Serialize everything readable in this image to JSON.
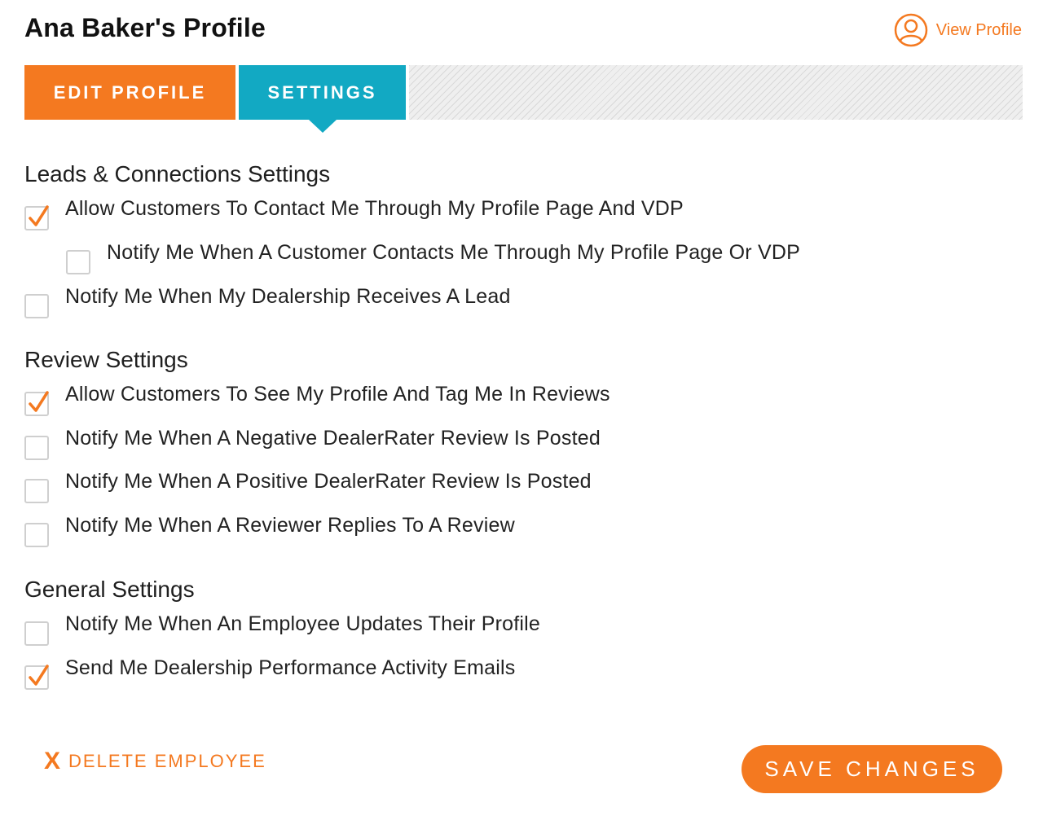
{
  "header": {
    "title": "Ana Baker's Profile",
    "view_profile_label": "View Profile"
  },
  "tabs": [
    {
      "label": "EDIT PROFILE",
      "active": false
    },
    {
      "label": "SETTINGS",
      "active": true
    }
  ],
  "sections": [
    {
      "title": "Leads & Connections Settings",
      "options": [
        {
          "label": "Allow Customers To Contact Me Through My Profile Page And VDP",
          "checked": true
        },
        {
          "label": "Notify Me When A Customer Contacts Me Through My Profile Page Or VDP",
          "checked": false
        },
        {
          "label": "Notify Me When My Dealership Receives A Lead",
          "checked": false
        }
      ]
    },
    {
      "title": "Review Settings",
      "options": [
        {
          "label": "Allow Customers To See My Profile And Tag Me In Reviews",
          "checked": true
        },
        {
          "label": "Notify Me When A Negative DealerRater Review Is Posted",
          "checked": false
        },
        {
          "label": "Notify Me When A Positive DealerRater Review Is Posted",
          "checked": false
        },
        {
          "label": "Notify Me When A Reviewer Replies To A Review",
          "checked": false
        }
      ]
    },
    {
      "title": "General Settings",
      "options": [
        {
          "label": "Notify Me When An Employee Updates Their Profile",
          "checked": false
        },
        {
          "label": "Send Me Dealership Performance Activity Emails",
          "checked": true
        }
      ]
    }
  ],
  "footer": {
    "delete_icon": "X",
    "delete_label": "DELETE EMPLOYEE",
    "save_label": "SAVE CHANGES"
  },
  "colors": {
    "accent_orange": "#f47920",
    "accent_teal": "#12a9c3"
  },
  "icons": {
    "view_profile": "user-circle-icon",
    "checkmark": "checkmark-icon",
    "delete": "x-icon"
  }
}
